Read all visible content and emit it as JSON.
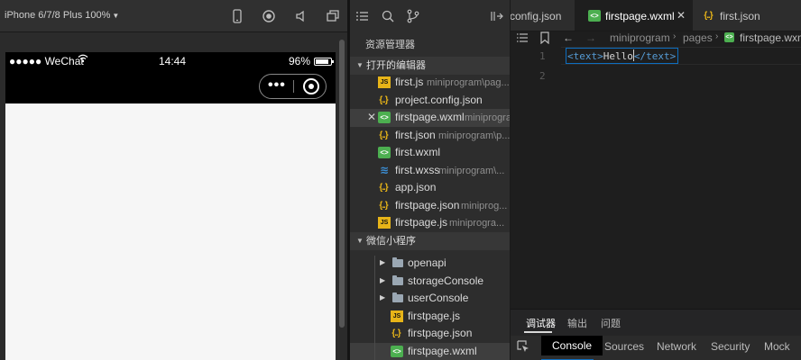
{
  "simulator": {
    "device": "iPhone 6/7/8 Plus 100%",
    "toolbar_icons": [
      "phone-icon",
      "record-icon",
      "speaker-icon",
      "multiwindow-icon"
    ],
    "status_bar": {
      "carrier": "●●●●● WeChat",
      "time": "14:44",
      "battery": "96%"
    }
  },
  "explorer": {
    "toolbar_icons": [
      "list-icon",
      "search-icon",
      "branch-icon",
      "split-icon"
    ],
    "title": "资源管理器",
    "open_editors": {
      "label": "打开的编辑器",
      "items": [
        {
          "name": "first.js",
          "path": "miniprogram\\pag...",
          "type": "js"
        },
        {
          "name": "project.config.json",
          "path": "",
          "type": "json"
        },
        {
          "name": "firstpage.wxml",
          "path": "miniprogra...",
          "type": "wxml",
          "close": "✕"
        },
        {
          "name": "first.json",
          "path": "miniprogram\\p...",
          "type": "json"
        },
        {
          "name": "first.wxml",
          "path": "",
          "type": "wxml"
        },
        {
          "name": "first.wxss",
          "path": "miniprogram\\...",
          "type": "wxss"
        },
        {
          "name": "app.json",
          "path": "",
          "type": "json"
        },
        {
          "name": "firstpage.json",
          "path": "miniprog...",
          "type": "json"
        },
        {
          "name": "firstpage.js",
          "path": "miniprogra...",
          "type": "js"
        }
      ]
    },
    "project": {
      "label": "微信小程序",
      "folders": [
        "openapi",
        "storageConsole",
        "userConsole"
      ],
      "files": [
        {
          "name": "firstpage.js",
          "type": "js"
        },
        {
          "name": "firstpage.json",
          "type": "json"
        },
        {
          "name": "firstpage.wxml",
          "type": "wxml"
        }
      ]
    }
  },
  "editor": {
    "tabs": [
      {
        "label": "config.json",
        "type": ""
      },
      {
        "label": "firstpage.wxml",
        "type": "wxml",
        "close": "✕"
      },
      {
        "label": "first.json",
        "type": "json"
      }
    ],
    "breadcrumb": [
      "miniprogram",
      "pages",
      "firstpage.wxml"
    ],
    "line_numbers": [
      "1",
      "2"
    ],
    "code": {
      "open_tag": "<text>",
      "content": "Hello",
      "close_tag": "</text>"
    }
  },
  "debugger": {
    "tabs": [
      "调试器",
      "输出",
      "问题"
    ],
    "devtools_tabs": [
      "Console",
      "Sources",
      "Network",
      "Security",
      "Mock"
    ]
  },
  "colors": {
    "js_icon": "#e7b418",
    "wxml_icon": "#4caf50",
    "wxss_icon": "#3b8fd6",
    "accent": "#0e6ec0"
  }
}
